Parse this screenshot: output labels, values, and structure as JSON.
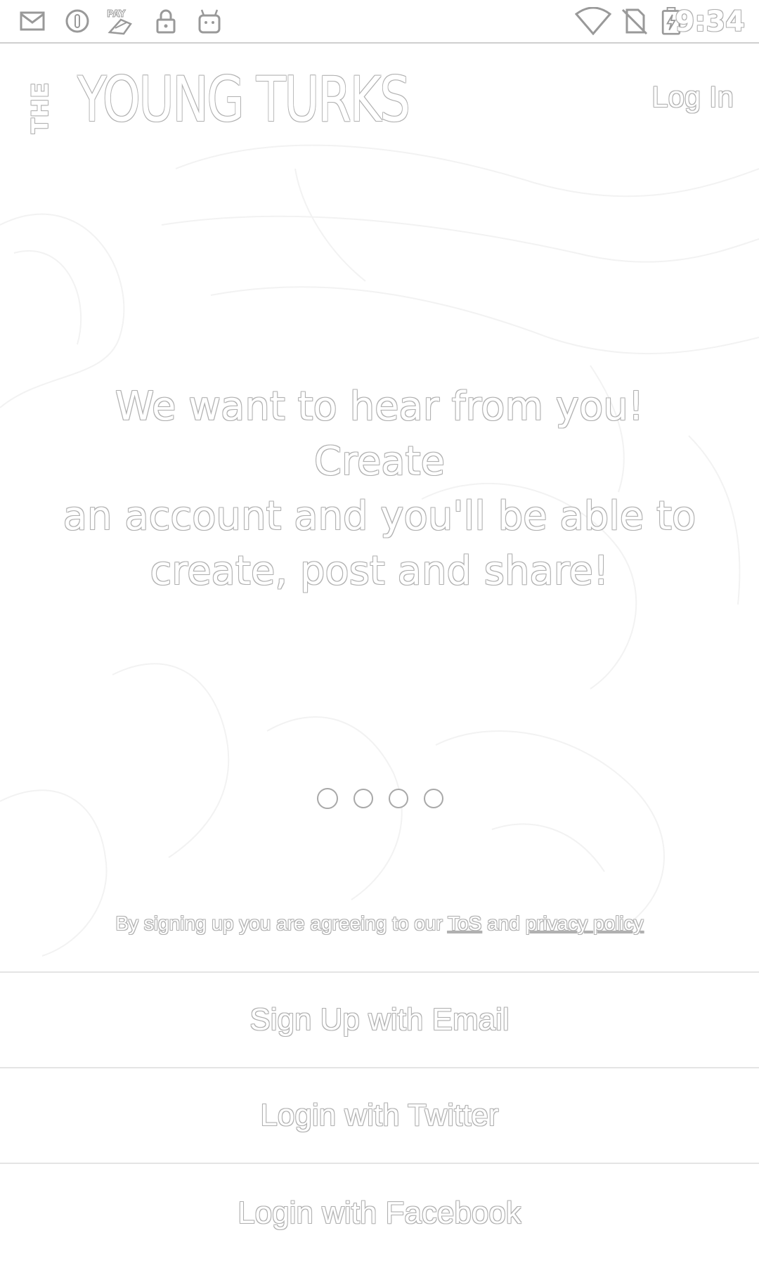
{
  "status_bar": {
    "icons": [
      "mail-icon",
      "circle-o-icon",
      "pay-icon",
      "lock-icon",
      "android-icon",
      "wifi-icon",
      "no-sim-icon",
      "battery-charging-icon"
    ],
    "time": "9:34"
  },
  "header": {
    "logo_prefix": "THE",
    "logo_name": "YOUNG TURKS",
    "login_label": "Log In"
  },
  "main": {
    "message_line1": "We want to hear from you!  Create",
    "message_line2": "an account and you'll be able to",
    "message_line3": "create, post and share!"
  },
  "pager": {
    "count": 4,
    "active_index": 0
  },
  "terms": {
    "prefix": "By signing up you are agreeing to our",
    "tos_label": "ToS",
    "conjunction": "and",
    "privacy_label": "privacy policy"
  },
  "actions": {
    "email_label": "Sign Up with Email",
    "twitter_label": "Login with Twitter",
    "facebook_label": "Login with Facebook"
  }
}
